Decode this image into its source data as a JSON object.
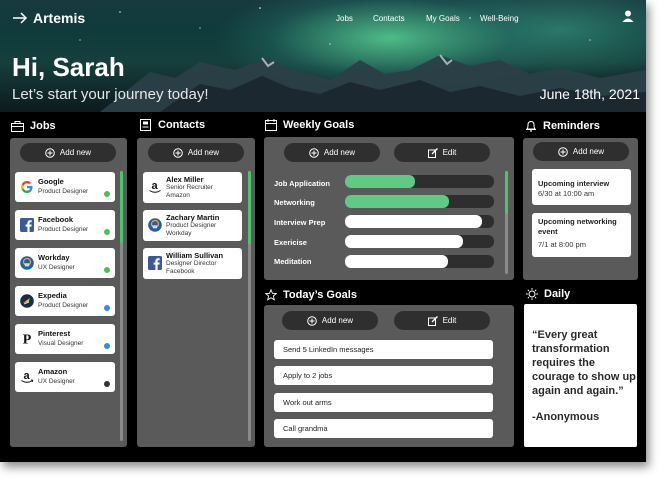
{
  "header": {
    "logo": "Artemis",
    "nav": [
      "Jobs",
      "Contacts",
      "My Goals",
      "Well-Being"
    ],
    "greeting": "Hi, Sarah",
    "subtitle": "Let’s start your journey today!",
    "date": "June 18th, 2021"
  },
  "jobs": {
    "title": "Jobs",
    "add_label": "Add new",
    "items": [
      {
        "name": "Google",
        "role": "Product Designer",
        "status": "green",
        "logo": "google-logo"
      },
      {
        "name": "Facebook",
        "role": "Product Designer",
        "status": "green",
        "logo": "facebook-logo"
      },
      {
        "name": "Workday",
        "role": "UX Designer",
        "status": "green",
        "logo": "workday-logo"
      },
      {
        "name": "Expedia",
        "role": "Product Designer",
        "status": "blue",
        "logo": "expedia-logo"
      },
      {
        "name": "Pinterest",
        "role": "Visual Designer",
        "status": "blue",
        "logo": "pinterest-logo"
      },
      {
        "name": "Amazon",
        "role": "UX Designer",
        "status": "black",
        "logo": "amazon-logo"
      }
    ]
  },
  "contacts": {
    "title": "Contacts",
    "add_label": "Add new",
    "items": [
      {
        "name": "Alex Miller",
        "role": "Senior Recruiter",
        "company": "Amazon",
        "logo": "amazon-logo"
      },
      {
        "name": "Zachary Martin",
        "role": "Product Designer",
        "company": "Workday",
        "logo": "workday-logo"
      },
      {
        "name": "William Sullivan",
        "role": "Designer Director",
        "company": "Facebook",
        "logo": "facebook-logo"
      }
    ]
  },
  "weekly_goals": {
    "title": "Weekly Goals",
    "add_label": "Add new",
    "edit_label": "Edit",
    "goals": [
      {
        "label": "Job Application",
        "progress": 0.47,
        "color": "#5fca83"
      },
      {
        "label": "Networking",
        "progress": 0.7,
        "color": "#5fca83"
      },
      {
        "label": "Interview Prep",
        "progress": 0.92,
        "color": "#ffffff"
      },
      {
        "label": "Exericise",
        "progress": 0.79,
        "color": "#ffffff"
      },
      {
        "label": "Meditation",
        "progress": 0.69,
        "color": "#ffffff"
      }
    ]
  },
  "todays_goals": {
    "title": "Today’s Goals",
    "add_label": "Add new",
    "edit_label": "Edit",
    "items": [
      "Send 5 LinkedIn messages",
      "Apply to 2 jobs",
      "Work out arms",
      "Call grandma"
    ]
  },
  "reminders": {
    "title": "Reminders",
    "add_label": "Add new",
    "items": [
      {
        "title": "Upcoming interview",
        "detail": "6/30 at 10:00 am"
      },
      {
        "title": "Upcoming networking event",
        "detail": "7/1 at 8:00 pm"
      }
    ]
  },
  "daily": {
    "title": "Daily",
    "quote": "“Every great transformation requires the courage to show up again and again.”",
    "author": "-Anonymous"
  },
  "colors": {
    "accent_green": "#4fc46a",
    "status_green": "#4bbf4f",
    "status_blue": "#2e8fe0",
    "status_black": "#333333",
    "panel": "#5a5a5a"
  }
}
